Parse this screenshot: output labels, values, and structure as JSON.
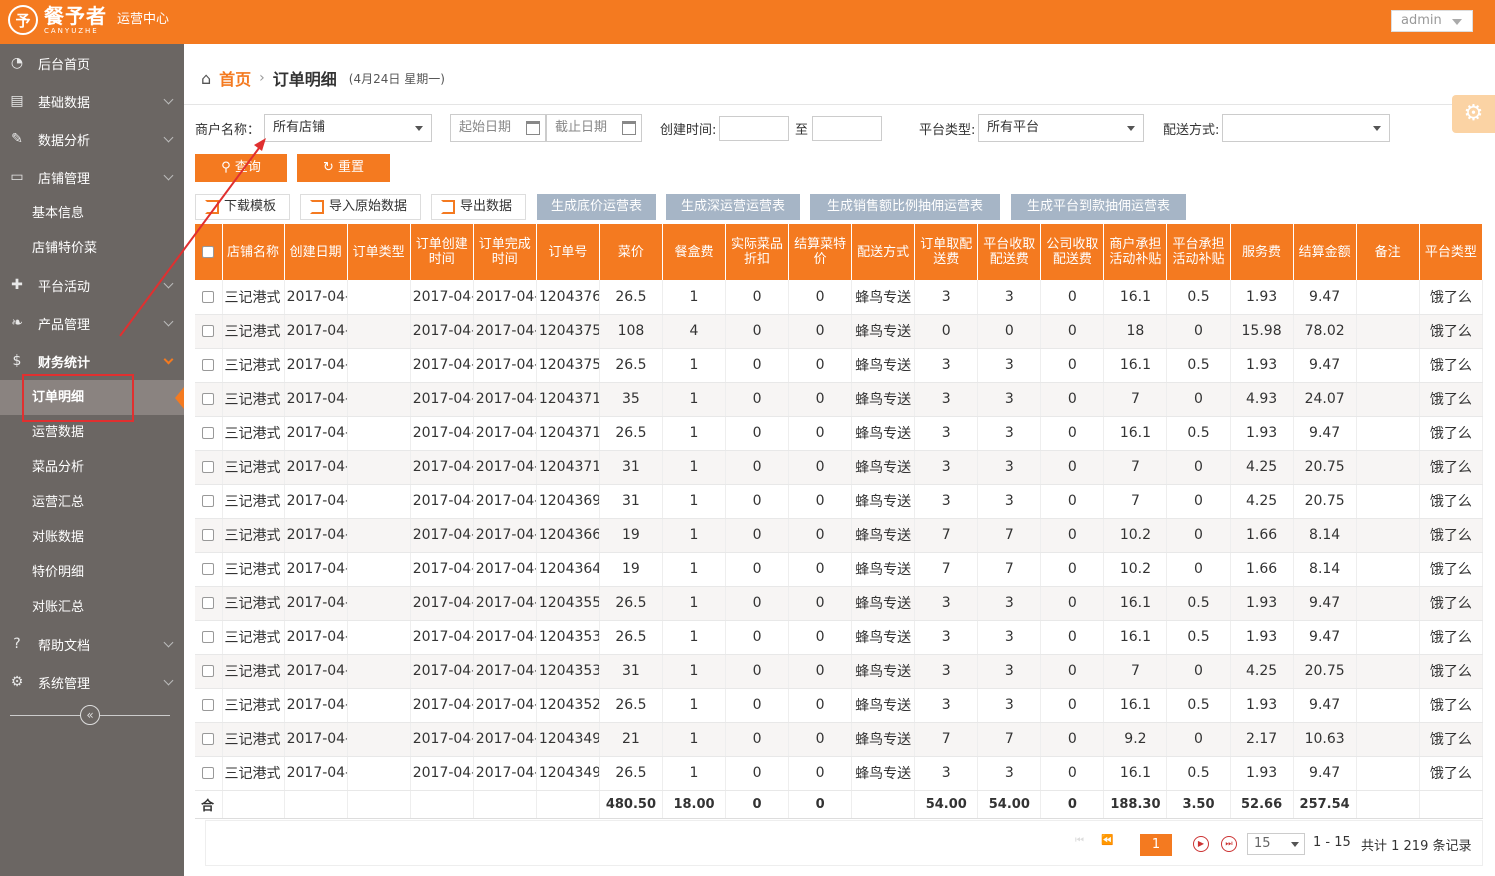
{
  "header": {
    "logo_mark": "予",
    "logo_title": "餐予者",
    "logo_sub": "CANYUZHE",
    "logo_center": "运营中心",
    "user": "admin"
  },
  "sidebar": {
    "items": [
      {
        "icon": "dashboard-icon",
        "glyph": "◔",
        "label": "后台首页"
      },
      {
        "icon": "book-icon",
        "glyph": "▤",
        "label": "基础数据"
      },
      {
        "icon": "magic-wand-icon",
        "glyph": "✎",
        "label": "数据分析"
      },
      {
        "icon": "inbox-icon",
        "glyph": "▭",
        "label": "店铺管理"
      },
      {
        "icon": "gift-icon",
        "glyph": "✚",
        "label": "平台活动"
      },
      {
        "icon": "leaf-icon",
        "glyph": "❧",
        "label": "产品管理"
      },
      {
        "icon": "dollar-icon",
        "glyph": "$",
        "label": "财务统计"
      },
      {
        "icon": "question-icon",
        "glyph": "?",
        "label": "帮助文档"
      },
      {
        "icon": "cogs-icon",
        "glyph": "⚙",
        "label": "系统管理"
      }
    ],
    "store_sub": [
      "基本信息",
      "店铺特价菜"
    ],
    "finance_sub": [
      "订单明细",
      "运营数据",
      "菜品分析",
      "运营汇总",
      "对账数据",
      "特价明细",
      "对账汇总"
    ],
    "collapse": "«"
  },
  "breadcrumb": {
    "home": "首页",
    "sep": "›",
    "current": "订单明细",
    "date": "(4月24日 星期一)"
  },
  "filters": {
    "merchant_label": "商户名称：",
    "merchant_value": "所有店铺",
    "start_date": "起始日期",
    "end_date": "截止日期",
    "created_label": "创建时间:",
    "to": "至",
    "platform_label": "平台类型:",
    "platform_value": "所有平台",
    "delivery_label": "配送方式:",
    "delivery_value": "",
    "query": "查询",
    "reset": "重置"
  },
  "toolbar": {
    "download_template": "下载模板",
    "import_raw": "导入原始数据",
    "export": "导出数据",
    "gen1": "生成底价运营表",
    "gen2": "生成深运营运营表",
    "gen3": "生成销售额比例抽佣运营表",
    "gen4": "生成平台到款抽佣运营表"
  },
  "table": {
    "headers": [
      "店铺名称",
      "创建日期",
      "订单类型",
      "订单创建时间",
      "订单完成时间",
      "订单号",
      "菜价",
      "餐盒费",
      "实际菜品折扣",
      "结算菜特价",
      "配送方式",
      "订单取配送费",
      "平台收取配送费",
      "公司收取配送费",
      "商户承担活动补贴",
      "平台承担活动补贴",
      "服务费",
      "结算金额",
      "备注",
      "平台类型"
    ],
    "rows": [
      [
        "三记港式",
        "2017-04-",
        "",
        "2017-04-",
        "2017-04-",
        "1204376",
        "26.5",
        "1",
        "0",
        "0",
        "蜂鸟专送",
        "3",
        "3",
        "0",
        "16.1",
        "0.5",
        "1.93",
        "9.47",
        "",
        "饿了么"
      ],
      [
        "三记港式",
        "2017-04-",
        "",
        "2017-04-",
        "2017-04-",
        "1204375",
        "108",
        "4",
        "0",
        "0",
        "蜂鸟专送",
        "0",
        "0",
        "0",
        "18",
        "0",
        "15.98",
        "78.02",
        "",
        "饿了么"
      ],
      [
        "三记港式",
        "2017-04-",
        "",
        "2017-04-",
        "2017-04-",
        "1204375",
        "26.5",
        "1",
        "0",
        "0",
        "蜂鸟专送",
        "3",
        "3",
        "0",
        "16.1",
        "0.5",
        "1.93",
        "9.47",
        "",
        "饿了么"
      ],
      [
        "三记港式",
        "2017-04-",
        "",
        "2017-04-",
        "2017-04-",
        "1204371",
        "35",
        "1",
        "0",
        "0",
        "蜂鸟专送",
        "3",
        "3",
        "0",
        "7",
        "0",
        "4.93",
        "24.07",
        "",
        "饿了么"
      ],
      [
        "三记港式",
        "2017-04-",
        "",
        "2017-04-",
        "2017-04-",
        "1204371",
        "26.5",
        "1",
        "0",
        "0",
        "蜂鸟专送",
        "3",
        "3",
        "0",
        "16.1",
        "0.5",
        "1.93",
        "9.47",
        "",
        "饿了么"
      ],
      [
        "三记港式",
        "2017-04-",
        "",
        "2017-04-",
        "2017-04-",
        "1204371",
        "31",
        "1",
        "0",
        "0",
        "蜂鸟专送",
        "3",
        "3",
        "0",
        "7",
        "0",
        "4.25",
        "20.75",
        "",
        "饿了么"
      ],
      [
        "三记港式",
        "2017-04-",
        "",
        "2017-04-",
        "2017-04-",
        "1204369",
        "31",
        "1",
        "0",
        "0",
        "蜂鸟专送",
        "3",
        "3",
        "0",
        "7",
        "0",
        "4.25",
        "20.75",
        "",
        "饿了么"
      ],
      [
        "三记港式",
        "2017-04-",
        "",
        "2017-04-",
        "2017-04-",
        "1204366",
        "19",
        "1",
        "0",
        "0",
        "蜂鸟专送",
        "7",
        "7",
        "0",
        "10.2",
        "0",
        "1.66",
        "8.14",
        "",
        "饿了么"
      ],
      [
        "三记港式",
        "2017-04-",
        "",
        "2017-04-",
        "2017-04-",
        "1204364",
        "19",
        "1",
        "0",
        "0",
        "蜂鸟专送",
        "7",
        "7",
        "0",
        "10.2",
        "0",
        "1.66",
        "8.14",
        "",
        "饿了么"
      ],
      [
        "三记港式",
        "2017-04-",
        "",
        "2017-04-",
        "2017-04-",
        "1204355",
        "26.5",
        "1",
        "0",
        "0",
        "蜂鸟专送",
        "3",
        "3",
        "0",
        "16.1",
        "0.5",
        "1.93",
        "9.47",
        "",
        "饿了么"
      ],
      [
        "三记港式",
        "2017-04-",
        "",
        "2017-04-",
        "2017-04-",
        "1204353",
        "26.5",
        "1",
        "0",
        "0",
        "蜂鸟专送",
        "3",
        "3",
        "0",
        "16.1",
        "0.5",
        "1.93",
        "9.47",
        "",
        "饿了么"
      ],
      [
        "三记港式",
        "2017-04-",
        "",
        "2017-04-",
        "2017-04-",
        "1204353",
        "31",
        "1",
        "0",
        "0",
        "蜂鸟专送",
        "3",
        "3",
        "0",
        "7",
        "0",
        "4.25",
        "20.75",
        "",
        "饿了么"
      ],
      [
        "三记港式",
        "2017-04-",
        "",
        "2017-04-",
        "2017-04-",
        "1204352",
        "26.5",
        "1",
        "0",
        "0",
        "蜂鸟专送",
        "3",
        "3",
        "0",
        "16.1",
        "0.5",
        "1.93",
        "9.47",
        "",
        "饿了么"
      ],
      [
        "三记港式",
        "2017-04-",
        "",
        "2017-04-",
        "2017-04-",
        "1204349",
        "21",
        "1",
        "0",
        "0",
        "蜂鸟专送",
        "7",
        "7",
        "0",
        "9.2",
        "0",
        "2.17",
        "10.63",
        "",
        "饿了么"
      ],
      [
        "三记港式",
        "2017-04-",
        "",
        "2017-04-",
        "2017-04-",
        "1204349",
        "26.5",
        "1",
        "0",
        "0",
        "蜂鸟专送",
        "3",
        "3",
        "0",
        "16.1",
        "0.5",
        "1.93",
        "9.47",
        "",
        "饿了么"
      ]
    ],
    "total": [
      "合",
      "",
      "",
      "",
      "",
      "",
      "",
      "480.50",
      "18.00",
      "0",
      "0",
      "",
      "54.00",
      "54.00",
      "0",
      "188.30",
      "3.50",
      "52.66",
      "257.54",
      "",
      ""
    ]
  },
  "pager": {
    "first": "⏮",
    "prev": "⏪",
    "current": "1",
    "next": "▶",
    "last": "⏭",
    "page_size": "15",
    "range": "1 - 15",
    "total": "共计 1 219 条记录"
  },
  "colors": {
    "accent": "#f47a20",
    "sidebar": "#6b6663",
    "gen_button": "#a6b5c6",
    "annotation": "#e03030"
  }
}
